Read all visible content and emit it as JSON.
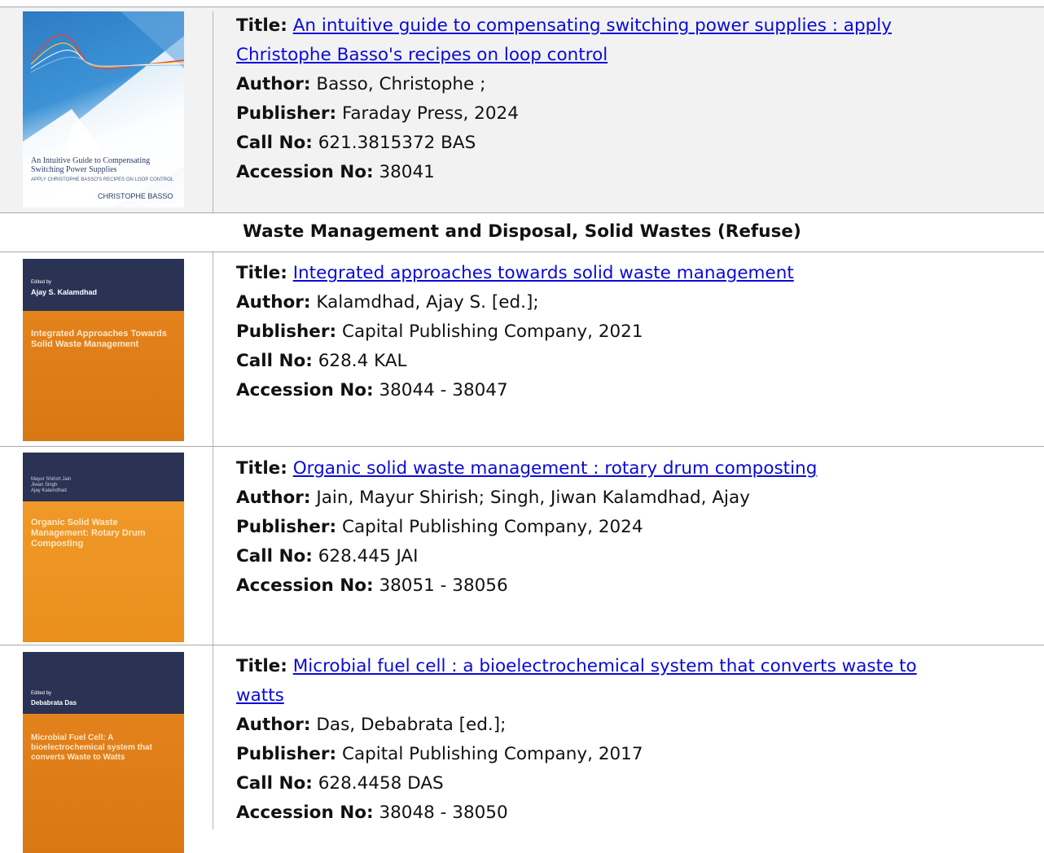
{
  "labels": {
    "title": "Title:",
    "author": "Author:",
    "publisher": "Publisher:",
    "call_no": "Call No:",
    "accession_no": "Accession No:"
  },
  "section_heading": "Waste Management and Disposal, Solid Wastes (Refuse)",
  "books": [
    {
      "title_line1": "An intuitive guide to compensating switching power supplies : apply",
      "title_line2": "Christophe Basso's recipes on loop control",
      "author": "Basso, Christophe ;",
      "publisher": "Faraday Press, 2024",
      "call_no": "621.3815372 BAS",
      "accession_no": "38041",
      "cover": {
        "title": "An Intuitive Guide to Compensating Switching Power Supplies",
        "subtitle": "APPLY CHRISTOPHE BASSO'S RECIPES ON LOOP CONTROL",
        "author": "CHRISTOPHE BASSO",
        "color": "#3d93d6"
      }
    },
    {
      "title_line1": "Integrated approaches towards solid waste management",
      "author": "Kalamdhad, Ajay S. [ed.];",
      "publisher": "Capital Publishing Company, 2021",
      "call_no": "628.4 KAL",
      "accession_no": "38044 - 38047",
      "cover": {
        "editor_label": "Edited by",
        "editor": "Ajay S. Kalamdhad",
        "title": "Integrated Approaches Towards Solid Waste Management",
        "color": "#e8871f"
      }
    },
    {
      "title_line1": "Organic solid waste management : rotary drum composting",
      "author": "Jain, Mayur Shirish; Singh, Jiwan Kalamdhad, Ajay",
      "publisher": "Capital Publishing Company, 2024",
      "call_no": "628.445 JAI",
      "accession_no": "38051 - 38056",
      "cover": {
        "authors": "Mayur Shirish Jain\nJiwan Singh\nAjay Kalamdhad",
        "title": "Organic Solid Waste Management: Rotary Drum Composting",
        "color": "#f09a2a"
      }
    },
    {
      "title_line1": "Microbial fuel cell : a bioelectrochemical system that converts waste to",
      "title_line2": "watts",
      "author": "Das, Debabrata [ed.];",
      "publisher": "Capital Publishing Company, 2017",
      "call_no": "628.4458 DAS",
      "accession_no": "38048 - 38050",
      "cover": {
        "editor_label": "Edited by",
        "editor": "Debabrata Das",
        "title": "Microbial Fuel Cell: A bioelectrochemical system that converts Waste to Watts",
        "color": "#e8871f"
      }
    }
  ]
}
